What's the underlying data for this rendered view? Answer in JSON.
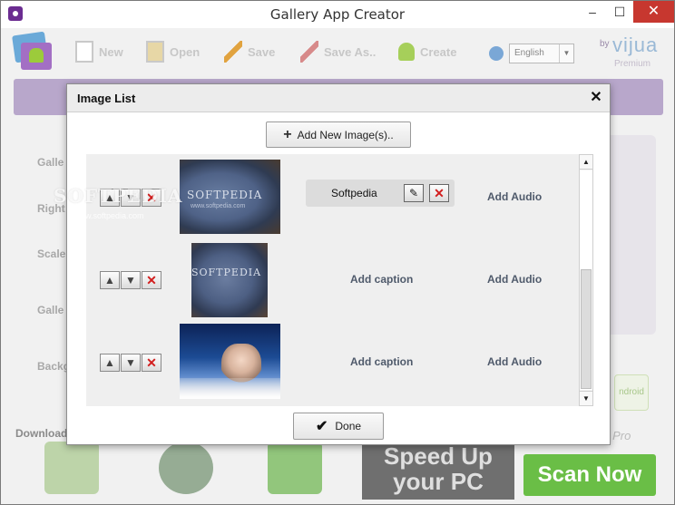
{
  "window": {
    "title": "Gallery App Creator",
    "min_glyph": "–",
    "max_glyph": "☐",
    "close_glyph": "✕"
  },
  "toolbar": {
    "new_label": "New",
    "open_label": "Open",
    "save_label": "Save",
    "save_as_label": "Save As..",
    "create_label": "Create",
    "language": "English",
    "brand_by": "by",
    "brand_name": "vijua",
    "brand_tier": "Premium"
  },
  "background": {
    "labels": [
      "Galle",
      "Right",
      "Scale",
      "Galle",
      "Backg"
    ],
    "download_label": "Download",
    "side_button": "ndroid",
    "ad_speed_line1": "Speed Up",
    "ad_speed_line2": "your PC",
    "ad_scan": "Scan Now",
    "ad_pro": "s Pro"
  },
  "watermark": {
    "main": "SOFTPEDIA",
    "sub": "www.softpedia.com"
  },
  "dialog": {
    "title": "Image List",
    "close_glyph": "✕",
    "add_images_label": "Add New Image(s)..",
    "done_label": "Done",
    "rows": [
      {
        "thumb_text": "SOFTPEDIA",
        "thumb_sub": "www.softpedia.com",
        "caption": "Softpedia",
        "has_caption": true,
        "audio_label": "Add Audio"
      },
      {
        "thumb_text": "SOFTPEDIA",
        "caption_link": "Add caption",
        "has_caption": false,
        "audio_label": "Add Audio"
      },
      {
        "caption_link": "Add caption",
        "has_caption": false,
        "audio_label": "Add Audio"
      }
    ],
    "row_up_glyph": "▲",
    "row_down_glyph": "▼",
    "row_delete_glyph": "✕"
  },
  "colors": {
    "banner": "#b8a7cb",
    "delete_red": "#d21d1d",
    "ad_green": "#6abe46"
  }
}
